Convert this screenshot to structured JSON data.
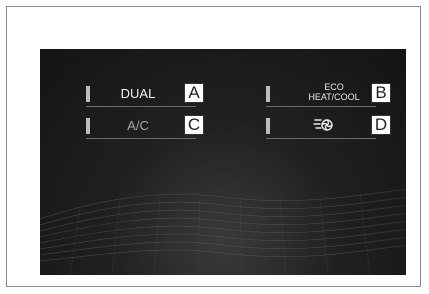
{
  "buttons": [
    {
      "label": "DUAL",
      "callout": "A"
    },
    {
      "label_line1": "ECO",
      "label_line2": "HEAT/COOL",
      "callout": "B"
    },
    {
      "label": "A/C",
      "callout": "C"
    },
    {
      "icon": "fan-airflow-icon",
      "callout": "D"
    }
  ],
  "colors": {
    "screen_background": "#1a1a1a",
    "label_text": "#f2f2f2",
    "indicator": "#bdbdbd",
    "callout_border": "#333333"
  }
}
